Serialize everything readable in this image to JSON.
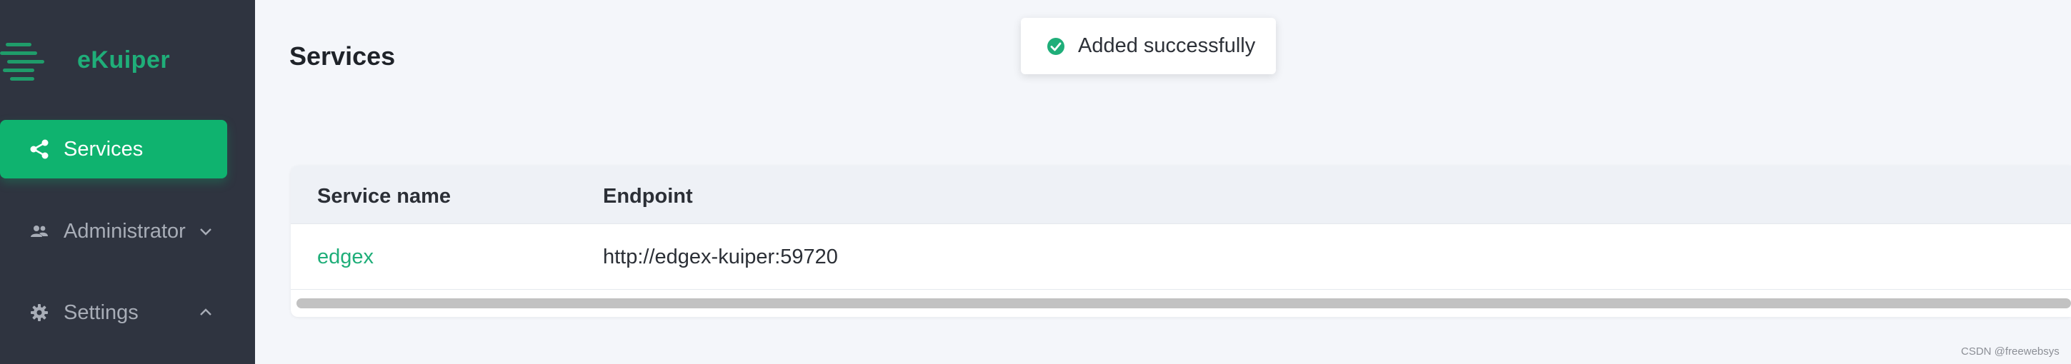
{
  "app": {
    "name": "eKuiper",
    "brand_color": "#1fae79",
    "accent_color": "#0fb36f",
    "sidebar_bg": "#2f3440"
  },
  "sidebar": {
    "items": [
      {
        "label": "Services",
        "icon": "share-icon",
        "active": true
      },
      {
        "label": "Administrator",
        "icon": "users-icon",
        "chevron": "chevron-down-icon"
      },
      {
        "label": "Settings",
        "icon": "gear-icon",
        "chevron": "chevron-up-icon"
      }
    ]
  },
  "page": {
    "title": "Services"
  },
  "toast": {
    "message": "Added successfully",
    "icon": "check-circle-icon",
    "color": "#1fae79"
  },
  "table": {
    "columns": [
      "Service name",
      "Endpoint"
    ],
    "rows": [
      {
        "name": "edgex",
        "endpoint": "http://edgex-kuiper:59720"
      }
    ]
  },
  "watermark": "CSDN @freewebsys"
}
